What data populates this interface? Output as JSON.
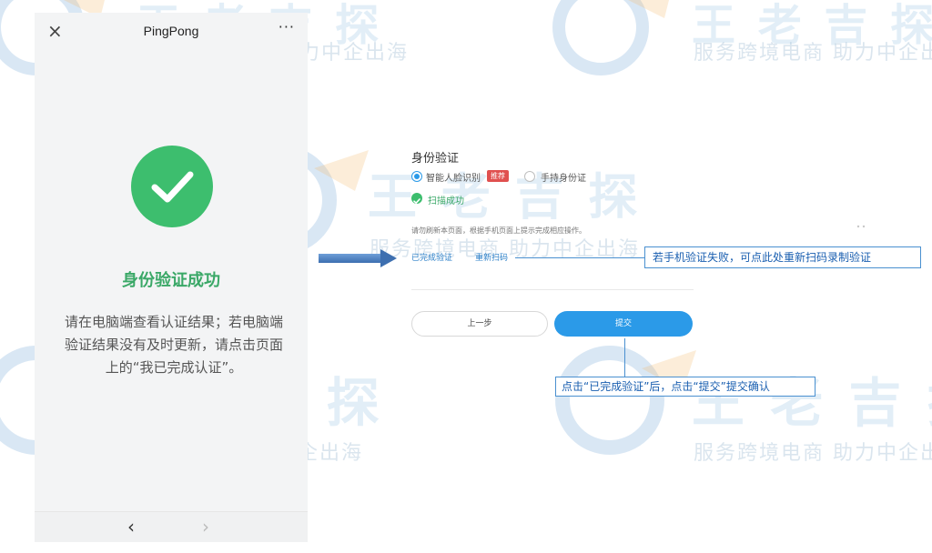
{
  "watermark": {
    "brand": "王 老 吉 探",
    "slogan": "服务跨境电商 助力中企出海"
  },
  "phone": {
    "title": "PingPong",
    "close_icon": "×",
    "more_icon": "···",
    "success_title": "身份验证成功",
    "success_desc_1": "请在电脑端查看认证结果；若电脑端",
    "success_desc_2": "验证结果没有及时更新，请点击页面",
    "success_desc_3": "上的“我已完成认证”。",
    "nav_back_icon": "‹",
    "nav_forward_icon": "›"
  },
  "form": {
    "title": "身份验证",
    "option_face": "智能人脸识别",
    "option_face_tag": "推荐",
    "option_id": "手持身份证",
    "scan_status": "扫描成功",
    "hint": "请勿刷新本页面，根据手机页面上提示完成相应操作。",
    "link_done": "已完成验证",
    "link_rescan": "重新扫码",
    "btn_prev": "上一步",
    "btn_submit": "提交"
  },
  "annotations": {
    "callout_rescan": "若手机验证失败，可点此处重新扫码录制验证",
    "callout_submit": "点击“已完成验证”后，点击“提交”提交确认"
  },
  "colors": {
    "success_green": "#3dbe6e",
    "primary_blue": "#2b9ae8",
    "annotation_blue": "#4a90d0",
    "recommend_red": "#e0504f"
  }
}
